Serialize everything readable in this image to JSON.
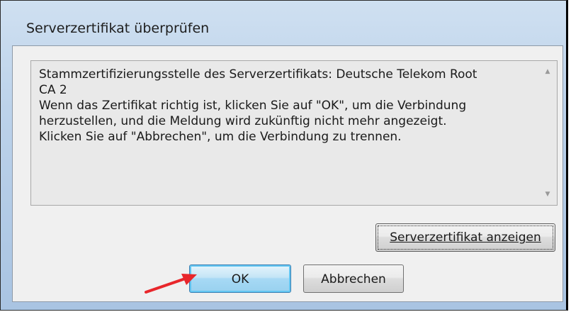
{
  "dialog": {
    "title": "Serverzertifikat überprüfen",
    "message_lines": [
      "Stammzertifizierungsstelle des Serverzertifikats: Deutsche Telekom Root",
      "CA 2",
      "Wenn das Zertifikat richtig ist, klicken Sie auf \"OK\", um die Verbindung",
      "herzustellen, und die Meldung wird zukünftig nicht mehr angezeigt.",
      "Klicken Sie auf \"Abbrechen\", um die Verbindung zu trennen."
    ],
    "buttons": {
      "show_cert": "Serverzertifikat anzeigen",
      "ok": "OK",
      "cancel": "Abbrechen"
    }
  },
  "icons": {
    "scroll_up": "scroll-up-arrow",
    "scroll_down": "scroll-down-arrow",
    "annotation": "red-arrow"
  },
  "colors": {
    "arrow": "#e8262b",
    "ok_button_border": "#3c7fb1"
  }
}
